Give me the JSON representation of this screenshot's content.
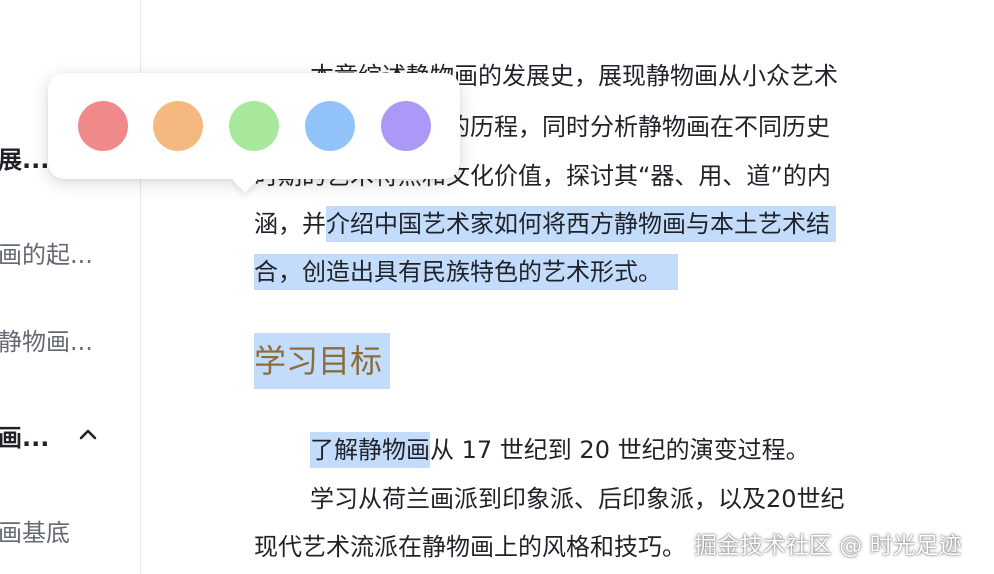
{
  "sidebar": {
    "items": [
      {
        "label": "展..."
      },
      {
        "label": "画的起..."
      },
      {
        "label": "静物画..."
      },
      {
        "label": "画...",
        "expanded": true,
        "icon": "chevron-up-icon"
      },
      {
        "label": "画基底"
      }
    ]
  },
  "content": {
    "intro": {
      "line1": "本章综述静物画的发展史，展现静物画从小众艺术",
      "line2": "到大众喜爱的一类的历程，同时分析静物画在不同历史",
      "line3": "时期的艺术特点和文化价值，探讨其“器、用、道”的内",
      "line4_plain": "涵，并",
      "line4_highlight": "介绍中国艺术家如何将西方静物画与本土艺术结",
      "line5_highlight": "合，创造出具有民族特色的艺术形式。"
    },
    "heading": "学习目标",
    "goal1_highlight": "了解静物画",
    "goal1_rest": "从 17 世纪到 20 世纪的演变过程。",
    "goal2_line1": "学习从荷兰画派到印象派、后印象派，以及20世纪",
    "goal2_line2": "现代艺术流派在静物画上的风格和技巧。"
  },
  "color_picker": {
    "swatches": [
      {
        "name": "red",
        "color": "#f08a8a"
      },
      {
        "name": "orange",
        "color": "#f5b97f"
      },
      {
        "name": "green",
        "color": "#a8e89a"
      },
      {
        "name": "blue",
        "color": "#91c3fa"
      },
      {
        "name": "purple",
        "color": "#ab98f7"
      }
    ]
  },
  "colors": {
    "highlight": "#c4dcfc",
    "heading": "#8a6d3b"
  },
  "watermark": "掘金技术社区 @ 时光足迹"
}
